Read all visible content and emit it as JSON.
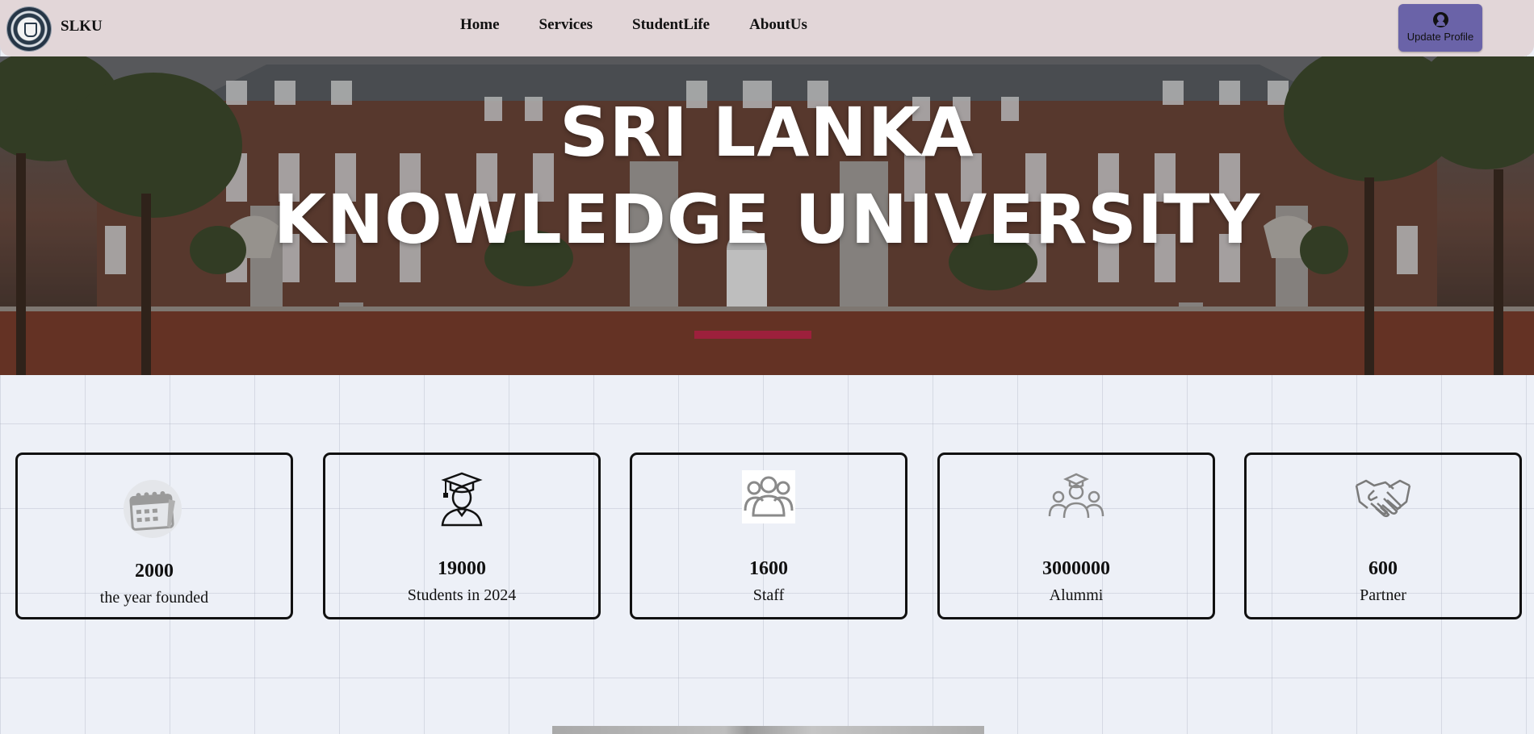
{
  "navbar": {
    "brand": "SLKU",
    "links": [
      "Home",
      "Services",
      "StudentLife",
      "AboutUs"
    ],
    "profile_button": "Update Profile"
  },
  "hero": {
    "title_line1": "SRI LANKA",
    "title_line2": "KNOWLEDGE UNIVERSITY"
  },
  "stats": [
    {
      "value": "2000",
      "label": "the year founded",
      "icon": "calendar-icon"
    },
    {
      "value": "19000",
      "label": "Students in 2024",
      "icon": "graduate-icon"
    },
    {
      "value": "1600",
      "label": "Staff",
      "icon": "people-group-icon"
    },
    {
      "value": "3000000",
      "label": "Alummi",
      "icon": "alumni-icon"
    },
    {
      "value": "600",
      "label": "Partner",
      "icon": "handshake-icon"
    }
  ],
  "colors": {
    "navbar_bg": "#e2d6d8",
    "profile_button_bg": "#6a63a8",
    "page_bg": "#edf0f7",
    "hero_text": "#ffffff"
  }
}
